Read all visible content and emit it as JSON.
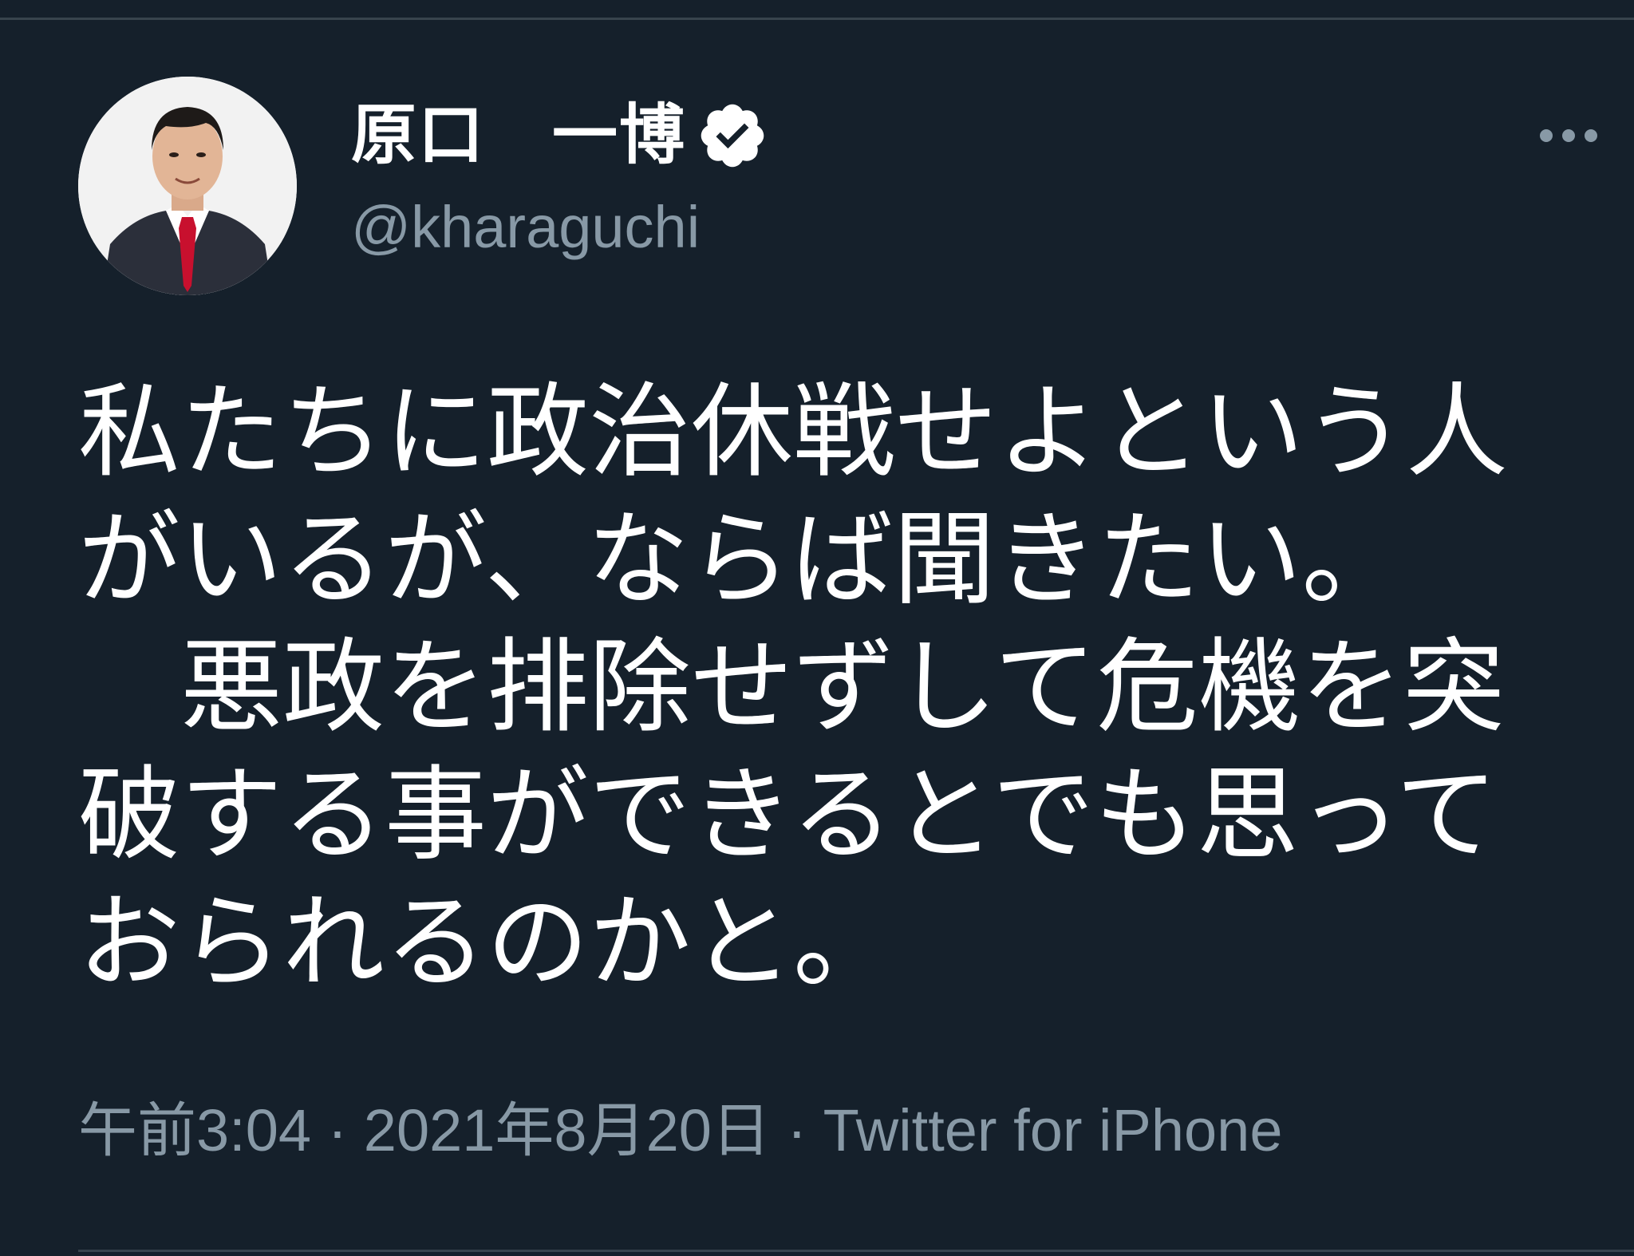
{
  "tweet": {
    "author": {
      "display_name": "原口　一博",
      "handle": "@kharaguchi",
      "verified": true,
      "verified_icon": "verified-badge-icon"
    },
    "more_icon": "more-dots-icon",
    "text_lines": [
      "私たちに政治休戦せよという人",
      "がいるが、ならば聞きたい。",
      "　悪政を排除せずして危機を突",
      "破する事ができるとでも思って",
      "おられるのかと。"
    ],
    "meta": {
      "time": "午前3:04",
      "separator": " · ",
      "date": "2021年8月20日",
      "source": "Twitter for iPhone"
    }
  },
  "colors": {
    "background": "#15202b",
    "text_primary": "#ffffff",
    "text_secondary": "#8899a6",
    "divider": "#38444d"
  }
}
